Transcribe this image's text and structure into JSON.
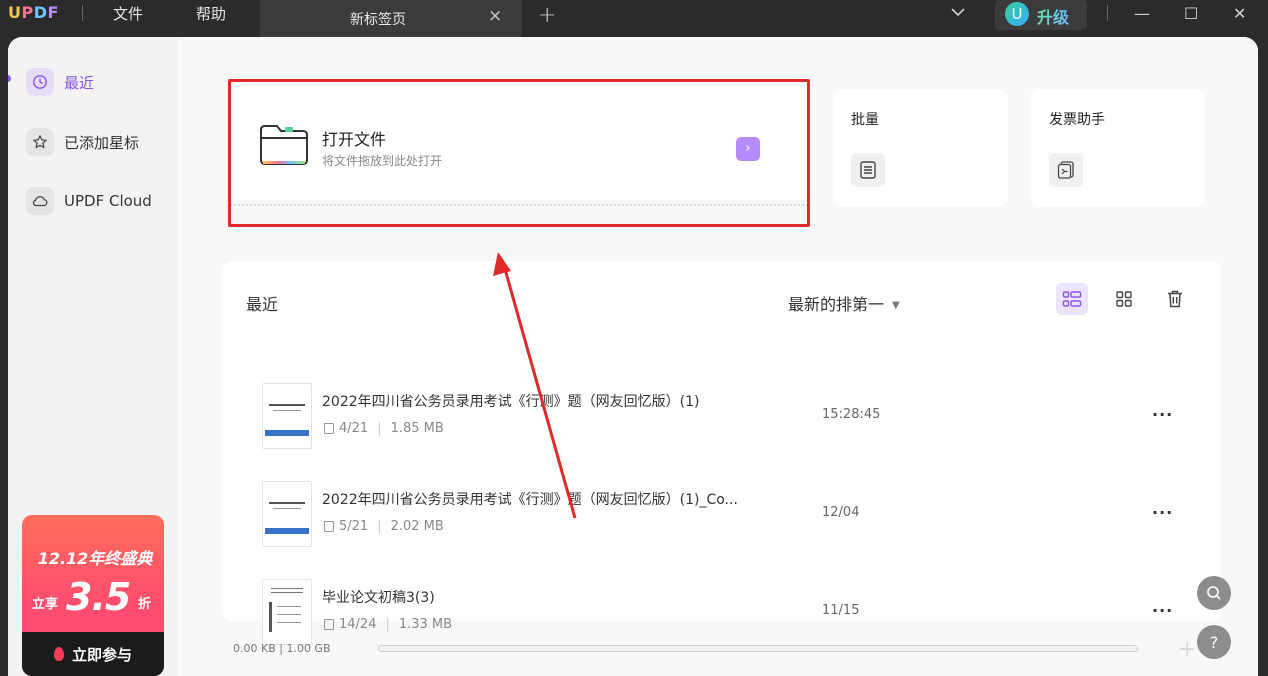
{
  "titlebar": {
    "logo": [
      "U",
      "P",
      "D",
      "F"
    ],
    "menu": [
      "文件",
      "帮助"
    ],
    "tab_title": "新标签页",
    "tab_close": "×",
    "tab_add": "+",
    "upgrade_avatar": "U",
    "upgrade_label": "升级",
    "win_min": "—",
    "win_max": "☐",
    "win_close": "✕"
  },
  "sidebar": {
    "items": [
      {
        "label": "最近",
        "icon": "clock-icon",
        "active": true
      },
      {
        "label": "已添加星标",
        "icon": "star-icon"
      },
      {
        "label": "UPDF Cloud",
        "icon": "cloud-icon"
      }
    ],
    "promo": {
      "title": "12.12年终盛典",
      "prefix": "立享",
      "discount": "3.5",
      "suffix": "折",
      "button": "立即参与"
    }
  },
  "open_card": {
    "title": "打开文件",
    "subtitle": "将文件拖放到此处打开",
    "arrow": "›"
  },
  "tools": [
    {
      "title": "批量",
      "icon": "batch-icon"
    },
    {
      "title": "发票助手",
      "icon": "invoice-icon"
    }
  ],
  "recent": {
    "title": "最近",
    "sort_label": "最新的排第一",
    "files": [
      {
        "name": "2022年四川省公务员录用考试《行测》题（网友回忆版）(1)",
        "pages": "4/21",
        "size": "1.85 MB",
        "time": "15:28:45"
      },
      {
        "name": "2022年四川省公务员录用考试《行测》题（网友回忆版）(1)_Co...",
        "pages": "5/21",
        "size": "2.02 MB",
        "time": "12/04"
      },
      {
        "name": "毕业论文初稿3(3)",
        "pages": "14/24",
        "size": "1.33 MB",
        "time": "11/15"
      }
    ],
    "more": "···"
  },
  "footer": {
    "storage": "0.00 KB | 1.00 GB",
    "help": "?"
  },
  "colors": {
    "accent": "#8a55e8",
    "highlight": "#e02a2a",
    "promo": "#ff5070"
  }
}
